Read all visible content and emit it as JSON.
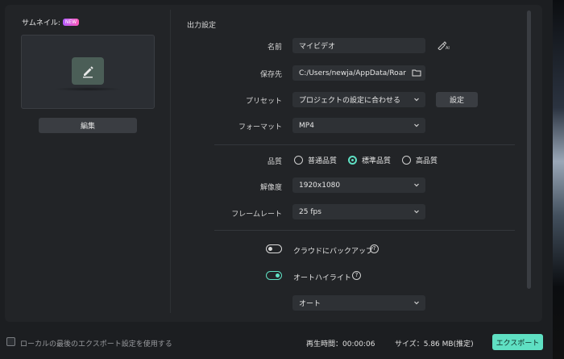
{
  "thumbnail": {
    "title": "サムネイル:",
    "badge": "NEW",
    "edit_label": "編集"
  },
  "output": {
    "section_title": "出力設定",
    "name_label": "名前",
    "name_value": "マイビデオ",
    "save_label": "保存先",
    "save_value": "C:/Users/newja/AppData/Roar",
    "preset_label": "プリセット",
    "preset_value": "プロジェクトの設定に合わせる",
    "preset_button": "設定",
    "format_label": "フォーマット",
    "format_value": "MP4",
    "quality_label": "品質",
    "quality_options": [
      "普通品質",
      "標準品質",
      "高品質"
    ],
    "quality_selected": 1,
    "resolution_label": "解像度",
    "resolution_value": "1920x1080",
    "framerate_label": "フレームレート",
    "framerate_value": "25 fps",
    "cloud_backup_label": "クラウドにバックアップ",
    "cloud_backup_on": false,
    "auto_highlight_label": "オートハイライト",
    "auto_highlight_on": true,
    "auto_value": "オート",
    "help_symbol": "?"
  },
  "footer": {
    "checkbox_label": "ローカルの最後のエクスポート設定を使用する",
    "duration": "再生時間：00:00:06",
    "size": "サイズ：5.86 MB(推定)",
    "export_label": "エクスポート"
  },
  "colors": {
    "accent": "#5fe0c3",
    "panel": "#222427",
    "field": "#2e3135"
  }
}
